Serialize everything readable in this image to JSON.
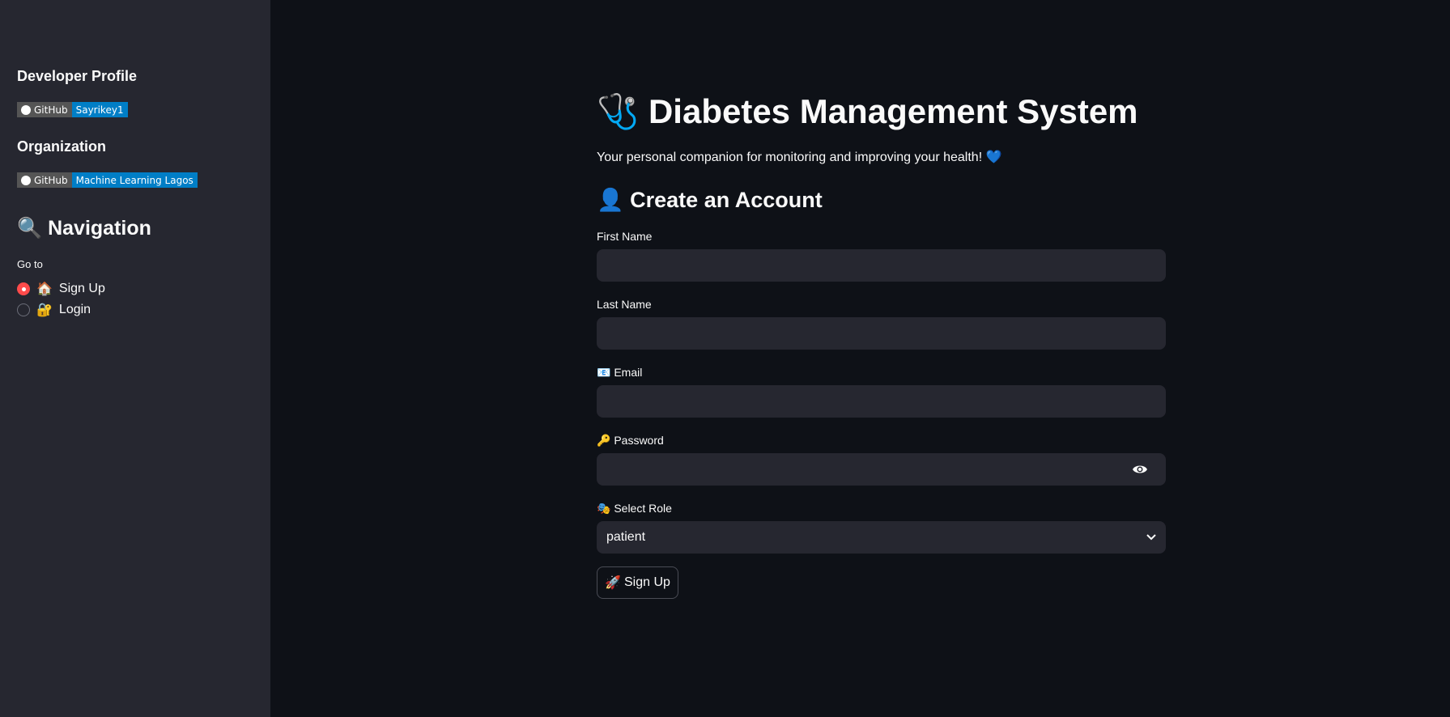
{
  "sidebar": {
    "developer_heading": "Developer Profile",
    "developer_badge": {
      "left": "GitHub",
      "right": "Sayrikey1"
    },
    "org_heading": "Organization",
    "org_badge": {
      "left": "GitHub",
      "right": "Machine Learning Lagos"
    },
    "nav_icon": "🔍",
    "nav_heading": "Navigation",
    "goto_label": "Go to",
    "options": [
      {
        "icon": "🏠",
        "label": "Sign Up",
        "selected": true
      },
      {
        "icon": "🔐",
        "label": "Login",
        "selected": false
      }
    ]
  },
  "main": {
    "title_icon": "🩺",
    "title": "Diabetes Management System",
    "subtitle": "Your personal companion for monitoring and improving your health! 💙",
    "form_icon": "👤",
    "form_heading": "Create an Account",
    "fields": {
      "first_name": {
        "label": "First Name",
        "value": ""
      },
      "last_name": {
        "label": "Last Name",
        "value": ""
      },
      "email": {
        "label": "📧 Email",
        "value": ""
      },
      "password": {
        "label": "🔑 Password",
        "value": ""
      },
      "role": {
        "label": "🎭 Select Role",
        "value": "patient"
      }
    },
    "submit": {
      "icon": "🚀",
      "label": "Sign Up"
    }
  },
  "colors": {
    "accent": "#ff4b4b",
    "badge_blue": "#007ec6",
    "sidebar_bg": "#262730",
    "main_bg": "#0e1117"
  }
}
